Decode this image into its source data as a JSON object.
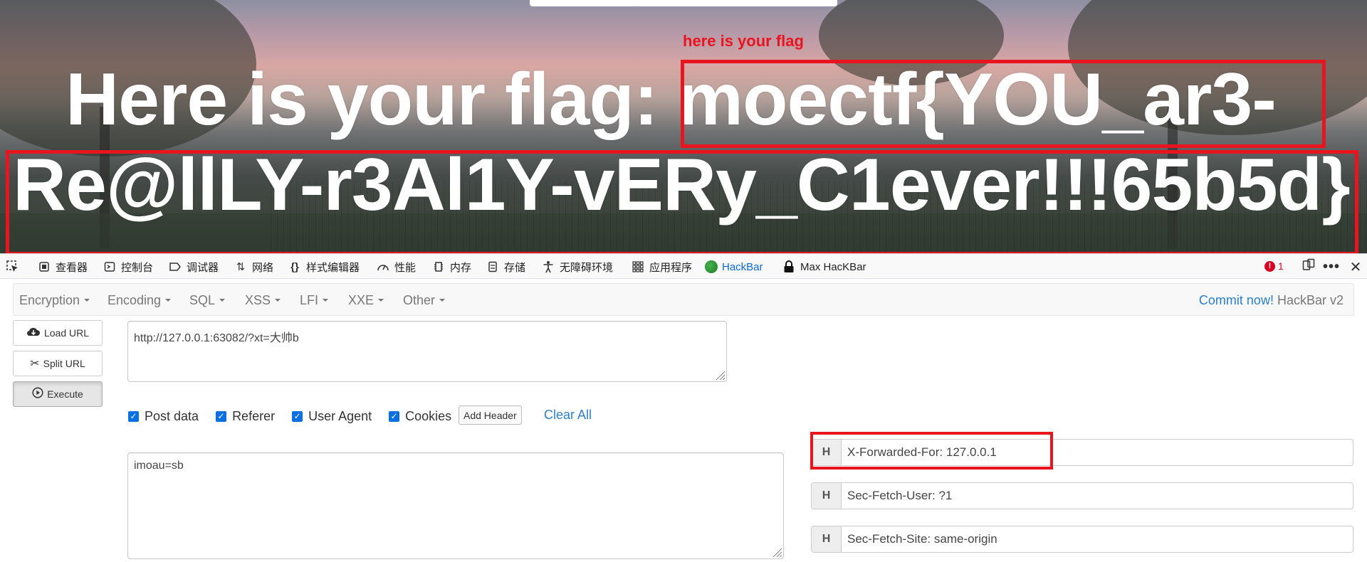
{
  "page": {
    "note": "here is your flag",
    "flag_line_1": "Here is your flag: moectf{YOU_ar3-",
    "flag_line_2": "Re@llLY-r3Al1Y-vERy_C1ever!!!65b5d}"
  },
  "devtools": {
    "tabs": [
      {
        "icon": "inspector-icon",
        "label": "查看器"
      },
      {
        "icon": "console-icon",
        "label": "控制台"
      },
      {
        "icon": "debugger-icon",
        "label": "调试器"
      },
      {
        "icon": "network-icon",
        "label": "网络"
      },
      {
        "icon": "style-editor-icon",
        "label": "样式编辑器"
      },
      {
        "icon": "performance-icon",
        "label": "性能"
      },
      {
        "icon": "memory-icon",
        "label": "内存"
      },
      {
        "icon": "storage-icon",
        "label": "存储"
      },
      {
        "icon": "accessibility-icon",
        "label": "无障碍环境"
      },
      {
        "icon": "application-icon",
        "label": "应用程序"
      },
      {
        "icon": "hackbar-icon",
        "label": "HackBar"
      },
      {
        "icon": "max-hackbar-icon",
        "label": "Max HacKBar"
      }
    ],
    "error_count": "1",
    "active_tab": "HackBar"
  },
  "hackbar": {
    "menu": [
      "Encryption",
      "Encoding",
      "SQL",
      "XSS",
      "LFI",
      "XXE",
      "Other"
    ],
    "commit_link": "Commit now!",
    "version": "HackBar v2",
    "buttons": {
      "load": "Load URL",
      "split": "Split URL",
      "execute": "Execute"
    },
    "url_value": "http://127.0.0.1:63082/?xt=大帅b",
    "options": [
      {
        "label": "Post data",
        "checked": true
      },
      {
        "label": "Referer",
        "checked": true
      },
      {
        "label": "User Agent",
        "checked": true
      },
      {
        "label": "Cookies",
        "checked": true
      }
    ],
    "add_header": "Add Header",
    "clear_all": "Clear All",
    "post_body": "imoau=sb",
    "headers": [
      {
        "tag": "H",
        "value": "X-Forwarded-For: 127.0.0.1"
      },
      {
        "tag": "H",
        "value": "Sec-Fetch-User: ?1"
      },
      {
        "tag": "H",
        "value": "Sec-Fetch-Site: same-origin"
      }
    ]
  },
  "colors": {
    "highlight": "#e8141e",
    "link": "#2a7fc8",
    "checkbox": "#0a6fe0"
  }
}
